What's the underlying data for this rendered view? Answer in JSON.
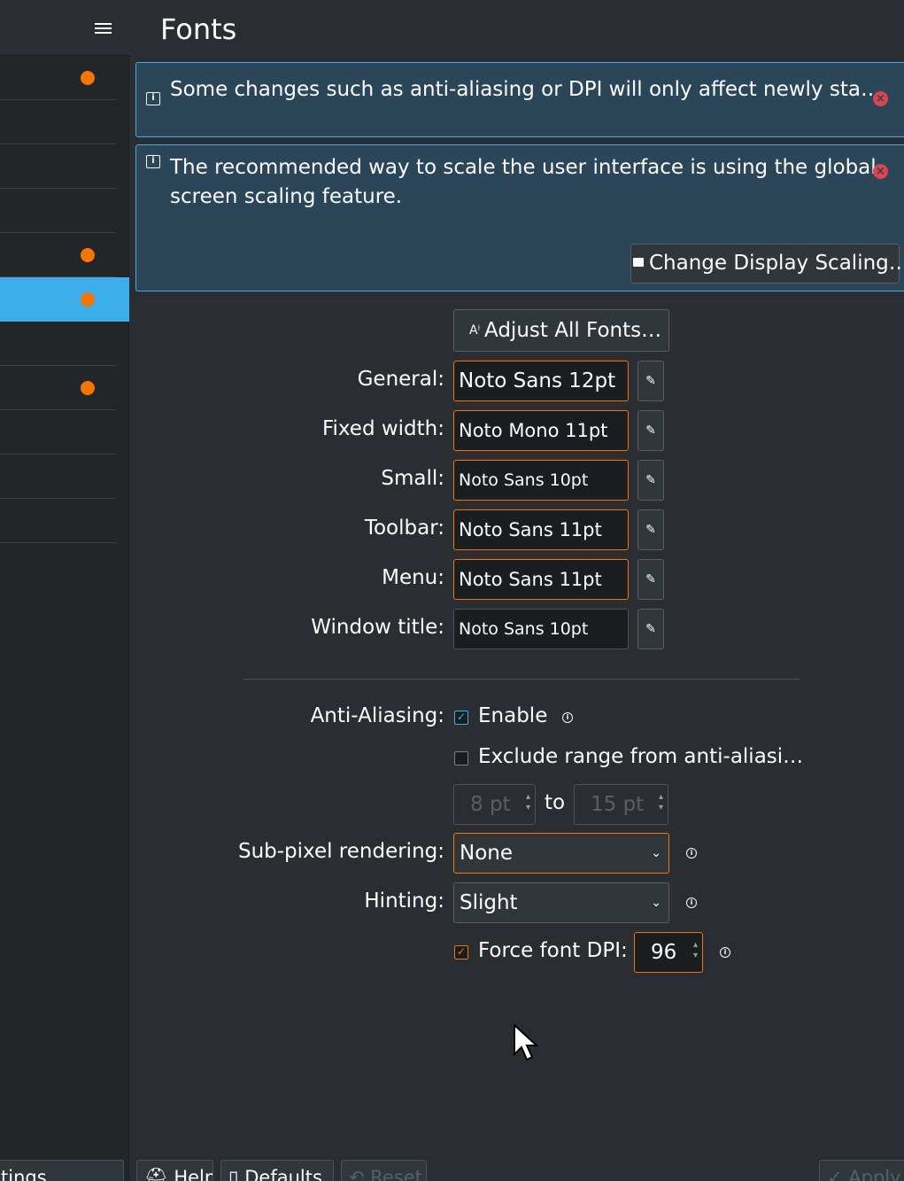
{
  "sidebar": {
    "items_count": 11,
    "footer_label": "tings"
  },
  "page": {
    "title": "Fonts"
  },
  "messages": [
    {
      "text": "Some changes such as anti-aliasing or DPI will only affect newly sta…"
    },
    {
      "line1": "The recommended way to scale the user interface is using the global",
      "line2": "screen scaling feature.",
      "action_label": "Change Display Scaling…"
    }
  ],
  "adjust_all_label": "Adjust All Fonts…",
  "fonts": {
    "general": {
      "label": "General:",
      "value": "Noto Sans 12pt"
    },
    "fixed": {
      "label": "Fixed width:",
      "value": "Noto Mono 11pt"
    },
    "small": {
      "label": "Small:",
      "value": "Noto Sans 10pt"
    },
    "toolbar": {
      "label": "Toolbar:",
      "value": "Noto Sans 11pt"
    },
    "menu": {
      "label": "Menu:",
      "value": "Noto Sans 11pt"
    },
    "window_title": {
      "label": "Window title:",
      "value": "Noto Sans 10pt"
    }
  },
  "antialiasing": {
    "label": "Anti-Aliasing:",
    "enable_label": "Enable",
    "enable_checked": true,
    "exclude_label": "Exclude range from anti-aliasi…",
    "exclude_checked": false,
    "range_from": "8 pt",
    "range_to_label": "to",
    "range_to": "15 pt"
  },
  "subpixel": {
    "label": "Sub-pixel rendering:",
    "value": "None"
  },
  "hinting": {
    "label": "Hinting:",
    "value": "Slight"
  },
  "force_dpi": {
    "label": "Force font DPI:",
    "checked": true,
    "value": "96"
  },
  "footer": {
    "help": "Help",
    "defaults": "Defaults",
    "reset": "Reset",
    "apply": "Apply"
  },
  "colors": {
    "accent": "#3daee9",
    "warning_dot": "#f67400",
    "close": "#da4453",
    "background": "#2a2e32"
  },
  "icons": [
    "hamburger-menu-icon",
    "info-icon",
    "close-icon",
    "monitor-icon",
    "font-icon",
    "edit-icon",
    "check-icon",
    "info-circle-icon",
    "chevron-down-icon"
  ]
}
